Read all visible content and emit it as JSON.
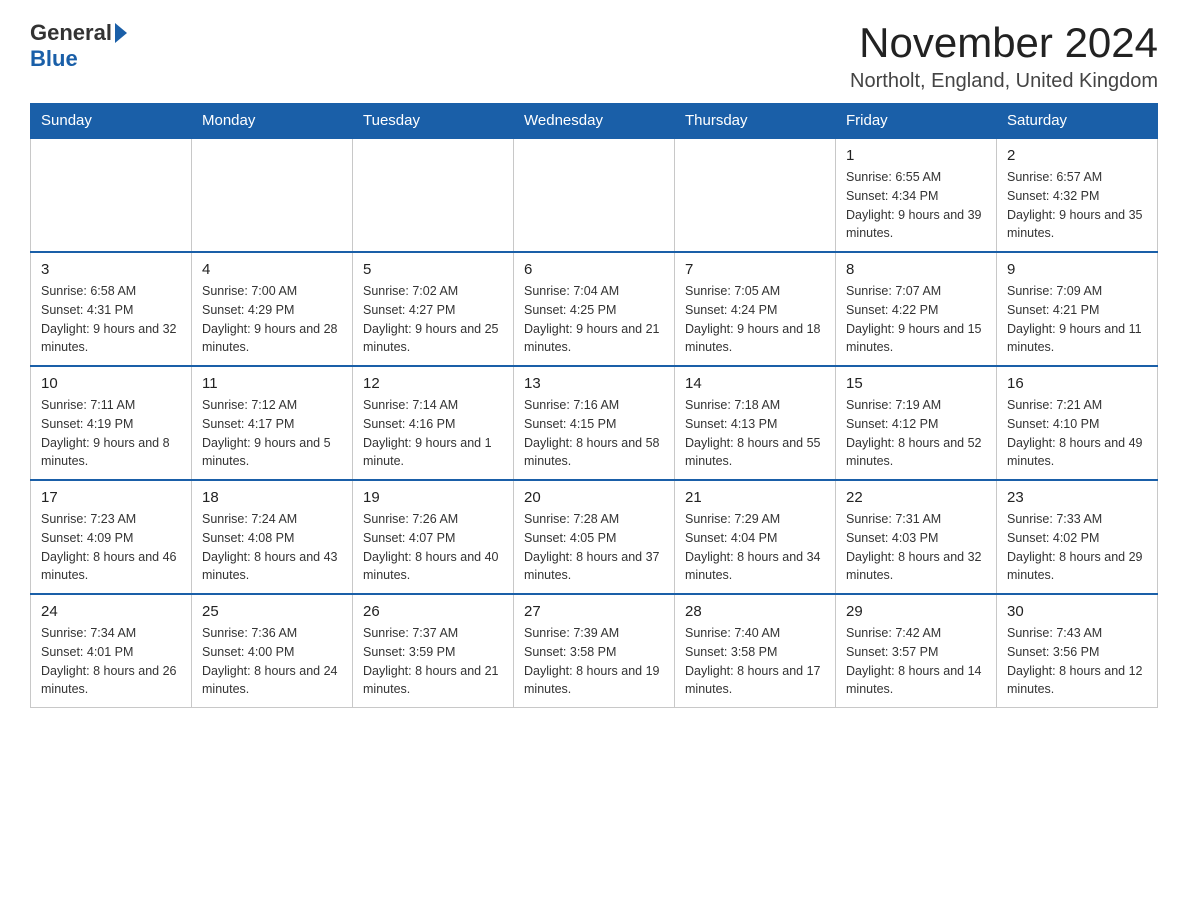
{
  "logo": {
    "general": "General",
    "blue": "Blue"
  },
  "title": "November 2024",
  "location": "Northolt, England, United Kingdom",
  "days_of_week": [
    "Sunday",
    "Monday",
    "Tuesday",
    "Wednesday",
    "Thursday",
    "Friday",
    "Saturday"
  ],
  "weeks": [
    [
      {
        "day": "",
        "sunrise": "",
        "sunset": "",
        "daylight": ""
      },
      {
        "day": "",
        "sunrise": "",
        "sunset": "",
        "daylight": ""
      },
      {
        "day": "",
        "sunrise": "",
        "sunset": "",
        "daylight": ""
      },
      {
        "day": "",
        "sunrise": "",
        "sunset": "",
        "daylight": ""
      },
      {
        "day": "",
        "sunrise": "",
        "sunset": "",
        "daylight": ""
      },
      {
        "day": "1",
        "sunrise": "Sunrise: 6:55 AM",
        "sunset": "Sunset: 4:34 PM",
        "daylight": "Daylight: 9 hours and 39 minutes."
      },
      {
        "day": "2",
        "sunrise": "Sunrise: 6:57 AM",
        "sunset": "Sunset: 4:32 PM",
        "daylight": "Daylight: 9 hours and 35 minutes."
      }
    ],
    [
      {
        "day": "3",
        "sunrise": "Sunrise: 6:58 AM",
        "sunset": "Sunset: 4:31 PM",
        "daylight": "Daylight: 9 hours and 32 minutes."
      },
      {
        "day": "4",
        "sunrise": "Sunrise: 7:00 AM",
        "sunset": "Sunset: 4:29 PM",
        "daylight": "Daylight: 9 hours and 28 minutes."
      },
      {
        "day": "5",
        "sunrise": "Sunrise: 7:02 AM",
        "sunset": "Sunset: 4:27 PM",
        "daylight": "Daylight: 9 hours and 25 minutes."
      },
      {
        "day": "6",
        "sunrise": "Sunrise: 7:04 AM",
        "sunset": "Sunset: 4:25 PM",
        "daylight": "Daylight: 9 hours and 21 minutes."
      },
      {
        "day": "7",
        "sunrise": "Sunrise: 7:05 AM",
        "sunset": "Sunset: 4:24 PM",
        "daylight": "Daylight: 9 hours and 18 minutes."
      },
      {
        "day": "8",
        "sunrise": "Sunrise: 7:07 AM",
        "sunset": "Sunset: 4:22 PM",
        "daylight": "Daylight: 9 hours and 15 minutes."
      },
      {
        "day": "9",
        "sunrise": "Sunrise: 7:09 AM",
        "sunset": "Sunset: 4:21 PM",
        "daylight": "Daylight: 9 hours and 11 minutes."
      }
    ],
    [
      {
        "day": "10",
        "sunrise": "Sunrise: 7:11 AM",
        "sunset": "Sunset: 4:19 PM",
        "daylight": "Daylight: 9 hours and 8 minutes."
      },
      {
        "day": "11",
        "sunrise": "Sunrise: 7:12 AM",
        "sunset": "Sunset: 4:17 PM",
        "daylight": "Daylight: 9 hours and 5 minutes."
      },
      {
        "day": "12",
        "sunrise": "Sunrise: 7:14 AM",
        "sunset": "Sunset: 4:16 PM",
        "daylight": "Daylight: 9 hours and 1 minute."
      },
      {
        "day": "13",
        "sunrise": "Sunrise: 7:16 AM",
        "sunset": "Sunset: 4:15 PM",
        "daylight": "Daylight: 8 hours and 58 minutes."
      },
      {
        "day": "14",
        "sunrise": "Sunrise: 7:18 AM",
        "sunset": "Sunset: 4:13 PM",
        "daylight": "Daylight: 8 hours and 55 minutes."
      },
      {
        "day": "15",
        "sunrise": "Sunrise: 7:19 AM",
        "sunset": "Sunset: 4:12 PM",
        "daylight": "Daylight: 8 hours and 52 minutes."
      },
      {
        "day": "16",
        "sunrise": "Sunrise: 7:21 AM",
        "sunset": "Sunset: 4:10 PM",
        "daylight": "Daylight: 8 hours and 49 minutes."
      }
    ],
    [
      {
        "day": "17",
        "sunrise": "Sunrise: 7:23 AM",
        "sunset": "Sunset: 4:09 PM",
        "daylight": "Daylight: 8 hours and 46 minutes."
      },
      {
        "day": "18",
        "sunrise": "Sunrise: 7:24 AM",
        "sunset": "Sunset: 4:08 PM",
        "daylight": "Daylight: 8 hours and 43 minutes."
      },
      {
        "day": "19",
        "sunrise": "Sunrise: 7:26 AM",
        "sunset": "Sunset: 4:07 PM",
        "daylight": "Daylight: 8 hours and 40 minutes."
      },
      {
        "day": "20",
        "sunrise": "Sunrise: 7:28 AM",
        "sunset": "Sunset: 4:05 PM",
        "daylight": "Daylight: 8 hours and 37 minutes."
      },
      {
        "day": "21",
        "sunrise": "Sunrise: 7:29 AM",
        "sunset": "Sunset: 4:04 PM",
        "daylight": "Daylight: 8 hours and 34 minutes."
      },
      {
        "day": "22",
        "sunrise": "Sunrise: 7:31 AM",
        "sunset": "Sunset: 4:03 PM",
        "daylight": "Daylight: 8 hours and 32 minutes."
      },
      {
        "day": "23",
        "sunrise": "Sunrise: 7:33 AM",
        "sunset": "Sunset: 4:02 PM",
        "daylight": "Daylight: 8 hours and 29 minutes."
      }
    ],
    [
      {
        "day": "24",
        "sunrise": "Sunrise: 7:34 AM",
        "sunset": "Sunset: 4:01 PM",
        "daylight": "Daylight: 8 hours and 26 minutes."
      },
      {
        "day": "25",
        "sunrise": "Sunrise: 7:36 AM",
        "sunset": "Sunset: 4:00 PM",
        "daylight": "Daylight: 8 hours and 24 minutes."
      },
      {
        "day": "26",
        "sunrise": "Sunrise: 7:37 AM",
        "sunset": "Sunset: 3:59 PM",
        "daylight": "Daylight: 8 hours and 21 minutes."
      },
      {
        "day": "27",
        "sunrise": "Sunrise: 7:39 AM",
        "sunset": "Sunset: 3:58 PM",
        "daylight": "Daylight: 8 hours and 19 minutes."
      },
      {
        "day": "28",
        "sunrise": "Sunrise: 7:40 AM",
        "sunset": "Sunset: 3:58 PM",
        "daylight": "Daylight: 8 hours and 17 minutes."
      },
      {
        "day": "29",
        "sunrise": "Sunrise: 7:42 AM",
        "sunset": "Sunset: 3:57 PM",
        "daylight": "Daylight: 8 hours and 14 minutes."
      },
      {
        "day": "30",
        "sunrise": "Sunrise: 7:43 AM",
        "sunset": "Sunset: 3:56 PM",
        "daylight": "Daylight: 8 hours and 12 minutes."
      }
    ]
  ]
}
